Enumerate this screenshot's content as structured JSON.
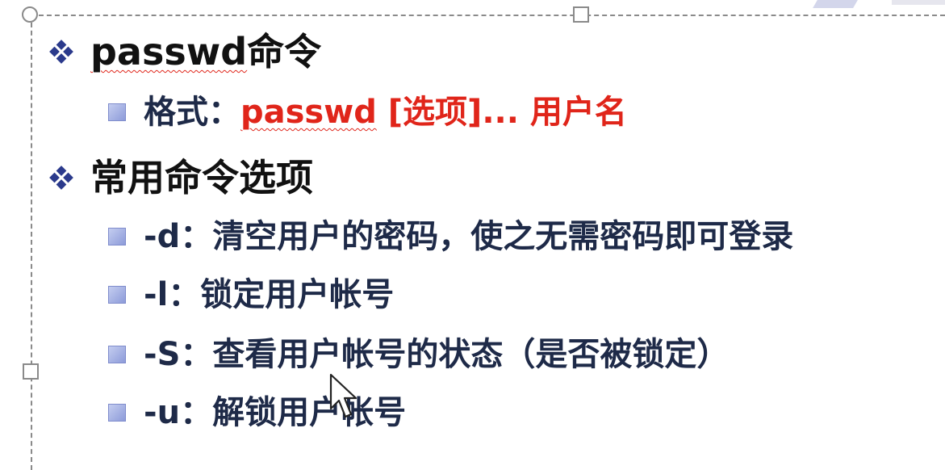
{
  "slide": {
    "title": {
      "command": "passwd",
      "suffix": "命令"
    },
    "format": {
      "label": "格式：",
      "command": "passwd",
      "rest": " [选项]... 用户名"
    },
    "options_heading": "常用命令选项",
    "options": [
      {
        "text": "-d：清空用户的密码，使之无需密码即可登录"
      },
      {
        "text": "-l：锁定用户帐号"
      },
      {
        "text": "-S：查看用户帐号的状态（是否被锁定）"
      },
      {
        "text": "-u：解锁用户帐号"
      }
    ]
  },
  "colors": {
    "accent_red": "#e0251a",
    "bullet_blue": "#2b3a8c",
    "body_text": "#1e2a48"
  },
  "icons": {
    "level1_bullet": "diamond-bullet-icon",
    "level2_bullet": "square-bullet-icon",
    "cursor": "mouse-pointer-icon"
  }
}
